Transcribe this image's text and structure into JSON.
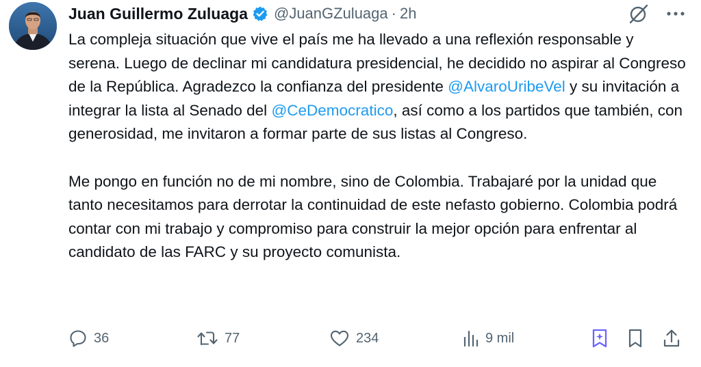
{
  "author": {
    "name": "Juan Guillermo Zuluaga",
    "handle": "@JuanGZuluaga",
    "separator": "·",
    "time": "2h"
  },
  "icons": {
    "verified": "verified-badge-icon",
    "grok": "grok-icon",
    "more": "more-icon",
    "reply": "reply-icon",
    "retweet": "retweet-icon",
    "like": "like-icon",
    "views": "views-icon",
    "grok_ask": "grok-ask-icon",
    "bookmark": "bookmark-icon",
    "share": "share-icon"
  },
  "colors": {
    "accent": "#1d9bf0",
    "muted": "#536471",
    "text": "#0f1419",
    "grok_active": "#6c63ff"
  },
  "tweet": {
    "p1_a": "La compleja situación que vive el país me ha llevado a una reflexión responsable y serena. Luego de declinar mi candidatura presidencial, he decidido no aspirar al Congreso de la República. Agradezco la confianza del presidente ",
    "mention1": "@AlvaroUribeVel",
    "p1_b": " y su invitación a integrar la lista al Senado del ",
    "mention2": "@CeDemocratico",
    "p1_c": ", así como a los partidos que también, con generosidad, me invitaron a formar parte de sus listas al Congreso.",
    "p2": "Me pongo en función no de mi nombre, sino de Colombia. Trabajaré por la unidad que tanto necesitamos para derrotar la continuidad de este nefasto gobierno. Colombia podrá contar con mi trabajo y compromiso para construir la mejor opción para enfrentar al candidato de las FARC y su proyecto comunista."
  },
  "metrics": {
    "replies": "36",
    "retweets": "77",
    "likes": "234",
    "views": "9 mil"
  }
}
